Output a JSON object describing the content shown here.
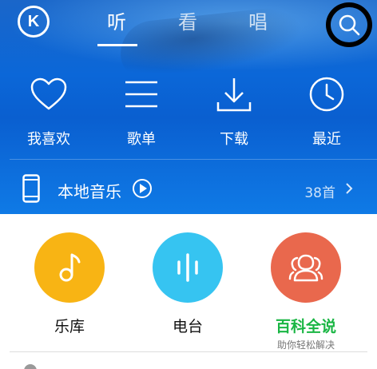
{
  "header": {
    "logo_letter": "K",
    "tabs": [
      {
        "label": "听",
        "active": true
      },
      {
        "label": "看",
        "active": false
      },
      {
        "label": "唱",
        "active": false
      }
    ]
  },
  "features": [
    {
      "label": "我喜欢",
      "icon": "heart-icon"
    },
    {
      "label": "歌单",
      "icon": "list-icon"
    },
    {
      "label": "下载",
      "icon": "download-icon"
    },
    {
      "label": "最近",
      "icon": "clock-icon"
    }
  ],
  "local_music": {
    "title": "本地音乐",
    "count": "38首"
  },
  "services": [
    {
      "label": "乐库",
      "color": "#f8b414",
      "icon": "music-note-icon"
    },
    {
      "label": "电台",
      "color": "#36c4f1",
      "icon": "radio-bars-icon"
    },
    {
      "label": "百科全说",
      "subtitle": "助你轻松解决",
      "color": "#e9684d",
      "icon": "people-icon"
    }
  ],
  "colors": {
    "accent": "#0b67d8",
    "green": "#1ab644"
  }
}
